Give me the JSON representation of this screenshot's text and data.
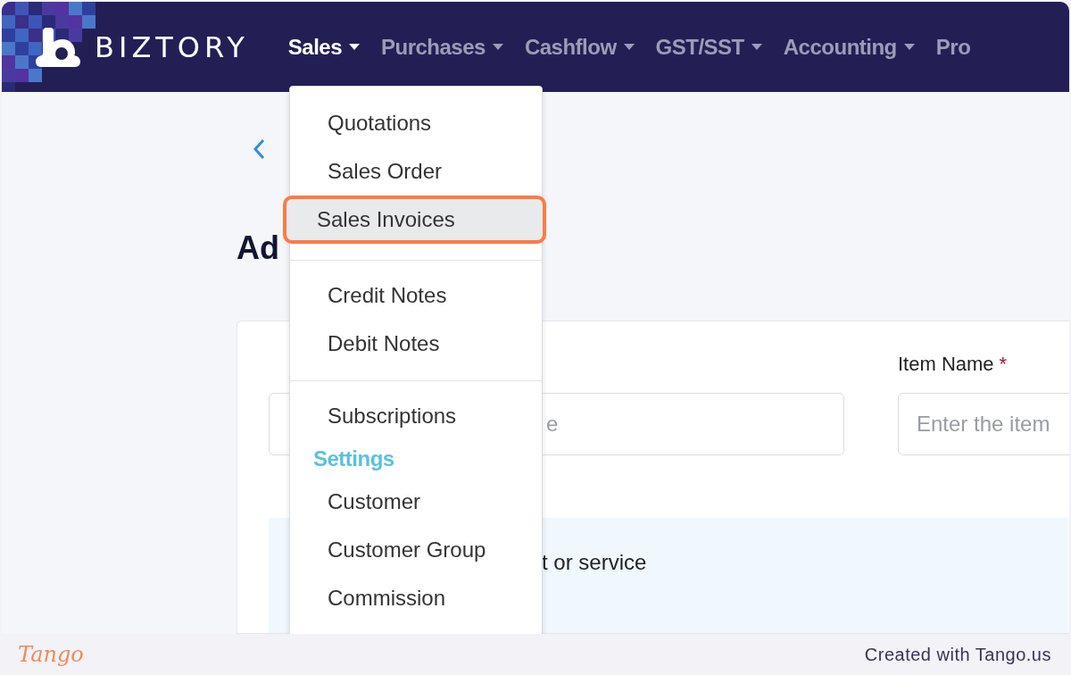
{
  "nav": {
    "brand": "BIZTORY",
    "items": [
      {
        "label": "Sales",
        "selected": true
      },
      {
        "label": "Purchases",
        "selected": false
      },
      {
        "label": "Cashflow",
        "selected": false
      },
      {
        "label": "GST/SST",
        "selected": false
      },
      {
        "label": "Accounting",
        "selected": false
      },
      {
        "label": "Pro",
        "selected": false
      }
    ]
  },
  "page": {
    "heading": "Ad",
    "field_fragment": "e",
    "item_name": {
      "label": "Item Name",
      "required_mark": "*",
      "placeholder": "Enter the item"
    },
    "banner_fragment": "t or service"
  },
  "menu": [
    {
      "kind": "item",
      "label": "Quotations",
      "selected": false
    },
    {
      "kind": "item",
      "label": "Sales Order",
      "selected": false
    },
    {
      "kind": "item",
      "label": "Sales Invoices",
      "selected": true
    },
    {
      "kind": "divider"
    },
    {
      "kind": "item",
      "label": "Credit Notes",
      "selected": false
    },
    {
      "kind": "item",
      "label": "Debit Notes",
      "selected": false
    },
    {
      "kind": "divider"
    },
    {
      "kind": "item",
      "label": "Subscriptions",
      "selected": false
    },
    {
      "kind": "header",
      "label": "Settings"
    },
    {
      "kind": "item",
      "label": "Customer",
      "selected": false
    },
    {
      "kind": "item",
      "label": "Customer Group",
      "selected": false
    },
    {
      "kind": "item",
      "label": "Commission",
      "selected": false
    }
  ],
  "footer": {
    "logo": "Tango",
    "credit": "Created with Tango.us"
  }
}
